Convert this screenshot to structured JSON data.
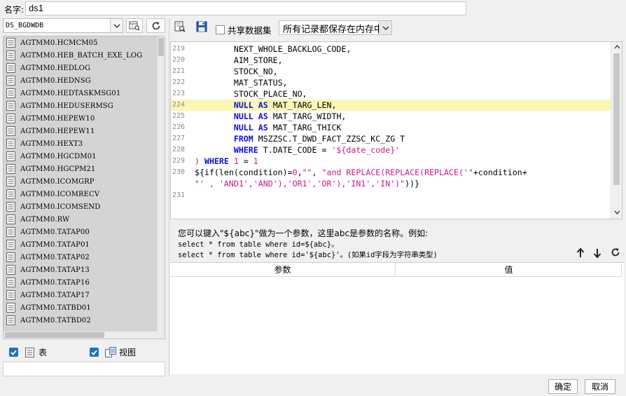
{
  "name_row": {
    "label": "名字:",
    "value": "ds1"
  },
  "left": {
    "datasource": "DS_BGDWDB",
    "tables": [
      "AGTMM0.HCMCM05",
      "AGTMM0.HEB_BATCH_EXE_LOG",
      "AGTMM0.HEDLOG",
      "AGTMM0.HEDNSG",
      "AGTMM0.HEDTASKMSG01",
      "AGTMM0.HEDUSERMSG",
      "AGTMM0.HEPEW10",
      "AGTMM0.HEPEW11",
      "AGTMM0.HEXT3",
      "AGTMM0.HGCDM01",
      "AGTMM0.HGCPM21",
      "AGTMM0.ICOMGRP",
      "AGTMM0.ICOMRECV",
      "AGTMM0.ICOMSEND",
      "AGTMM0.RW",
      "AGTMM0.TATAP00",
      "AGTMM0.TATAP01",
      "AGTMM0.TATAP02",
      "AGTMM0.TATAP13",
      "AGTMM0.TATAP16",
      "AGTMM0.TATAP17",
      "AGTMM0.TATBD01",
      "AGTMM0.TATBD02"
    ],
    "filter_table_label": "表",
    "filter_view_label": "视图"
  },
  "toolbar": {
    "share_label": "共享数据集",
    "memory_option": "所有记录都保存在内存中"
  },
  "editor": {
    "lines": [
      {
        "n": "219",
        "t": "        NEXT_WHOLE_BACKLOG_CODE,"
      },
      {
        "n": "220",
        "t": "        AIM_STORE,"
      },
      {
        "n": "221",
        "t": "        STOCK_NO,"
      },
      {
        "n": "222",
        "t": "        MAT_STATUS,"
      },
      {
        "n": "223",
        "t": "        STOCK_PLACE_NO,"
      },
      {
        "n": "224",
        "t": "        NULL AS MAT_TARG_LEN,"
      },
      {
        "n": "225",
        "t": "        NULL AS MAT_TARG_WIDTH,"
      },
      {
        "n": "226",
        "t": "        NULL AS MAT_TARG_THICK"
      },
      {
        "n": "227",
        "t": "        FROM MSZZSC.T_DWD_FACT_ZZSC_KC_ZG T"
      },
      {
        "n": "228",
        "t": "        WHERE T.DATE_CODE = '${date_code}'"
      },
      {
        "n": "229",
        "t": ") WHERE 1 = 1"
      },
      {
        "n": "230",
        "t": "${if(len(condition)=0,\"\", \"and REPLACE(REPLACE(REPLACE('\"+condition+"
      },
      {
        "n": "",
        "t": "\"' , 'AND1','AND'),'OR1','OR'),'IN1','IN')\"))}"
      },
      {
        "n": "231",
        "t": ""
      }
    ]
  },
  "hint": {
    "line1": "您可以键入\"${abc}\"做为一个参数，这里abc是参数的名称。例如:",
    "line2": "select * from table where id=${abc}。",
    "line3": "select * from table where id='${abc}'。(如果id字段为字符串类型)"
  },
  "params": {
    "col_param": "参数",
    "col_value": "值"
  },
  "buttons": {
    "ok": "确定",
    "cancel": "取消"
  }
}
